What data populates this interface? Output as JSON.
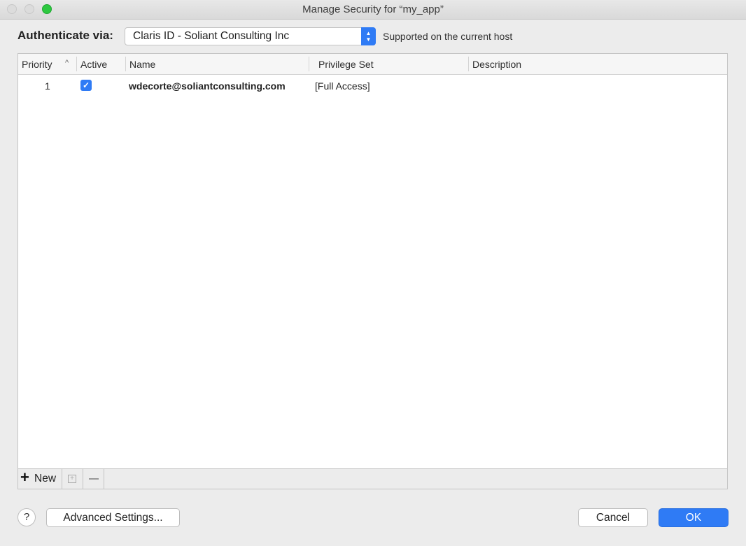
{
  "window": {
    "title": "Manage Security for “my_app”"
  },
  "auth": {
    "label": "Authenticate via:",
    "selected": "Claris ID - Soliant Consulting Inc",
    "support_note": "Supported on the current host"
  },
  "table": {
    "columns": [
      "Priority",
      "Active",
      "Name",
      "Privilege Set",
      "Description"
    ],
    "sort": {
      "column": "Priority",
      "direction": "ascending"
    },
    "rows": [
      {
        "priority": "1",
        "active": true,
        "name": "wdecorte@soliantconsulting.com",
        "privilege_set": "[Full Access]",
        "description": ""
      }
    ]
  },
  "toolbar": {
    "new_label": "New"
  },
  "footer": {
    "help_label": "?",
    "advanced_label": "Advanced Settings...",
    "cancel_label": "Cancel",
    "ok_label": "OK"
  },
  "colors": {
    "accent": "#2f7bf5",
    "window_bg": "#ececec",
    "zoom_green": "#2dc840"
  },
  "icons": [
    "close-traffic-light",
    "minimize-traffic-light",
    "zoom-traffic-light",
    "chevron-updown-icon",
    "sort-up-icon",
    "checkmark-icon",
    "plus-icon",
    "duplicate-icon",
    "minus-icon",
    "help-icon"
  ]
}
